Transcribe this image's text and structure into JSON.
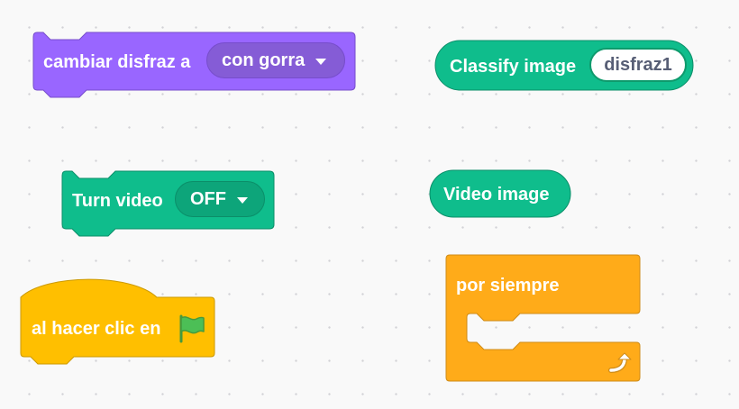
{
  "colors": {
    "looks": "#9966ff",
    "looks_dark": "#774dcb",
    "looks_field": "#855cd6",
    "extension": "#0fbd8c",
    "extension_dark": "#0b8e69",
    "extension_field": "#0da57a",
    "events": "#ffbf00",
    "events_dark": "#cc9900",
    "control": "#ffab19",
    "control_dark": "#cf8b17",
    "flag_green": "#4cbf56"
  },
  "blocks": {
    "change_costume": {
      "label": "cambiar disfraz a",
      "dropdown_value": "con gorra"
    },
    "classify_image": {
      "label": "Classify image",
      "input_value": "disfraz1"
    },
    "turn_video": {
      "label": "Turn video",
      "dropdown_value": "OFF"
    },
    "video_image": {
      "label": "Video image"
    },
    "when_flag_clicked": {
      "label": "al hacer clic en",
      "icon": "green-flag-icon"
    },
    "forever": {
      "label": "por siempre",
      "icon": "loop-arrow-icon"
    }
  }
}
